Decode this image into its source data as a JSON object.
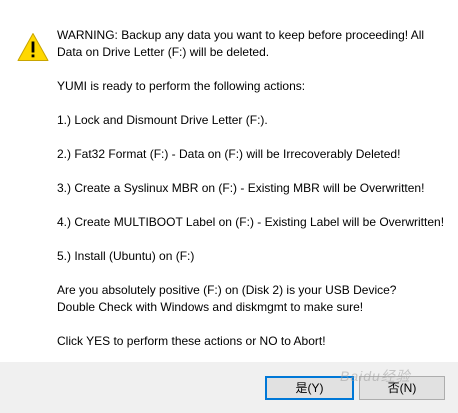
{
  "message": {
    "line1": "WARNING: Backup any data you want to keep before proceeding! All",
    "line2": "Data on Drive Letter (F:) will be deleted.",
    "line3": "YUMI is ready to perform the following actions:",
    "line4": "1.) Lock and Dismount Drive Letter (F:).",
    "line5": "2.) Fat32 Format (F:) - Data on (F:) will be Irrecoverably Deleted!",
    "line6": "3.) Create a Syslinux MBR on (F:) - Existing MBR will be Overwritten!",
    "line7": "4.) Create MULTIBOOT Label on (F:) - Existing Label will be Overwritten!",
    "line8": "5.) Install (Ubuntu) on (F:)",
    "line9": "Are you absolutely positive (F:) on (Disk 2) is your USB Device?",
    "line10": "Double Check with Windows and diskmgmt to make sure!",
    "line11": "Click YES to perform these actions or NO to Abort!"
  },
  "buttons": {
    "yes_label": "是(Y)",
    "no_label": "否(N)"
  },
  "icon": {
    "name": "warning-icon",
    "fill_color": "#ffd800",
    "mark_color": "#000000"
  },
  "watermark": {
    "text": "Baidu经验"
  },
  "colors": {
    "content_background": "#ffffff",
    "button_bar_background": "#f0f0f0",
    "default_button_border": "#0078d7"
  }
}
